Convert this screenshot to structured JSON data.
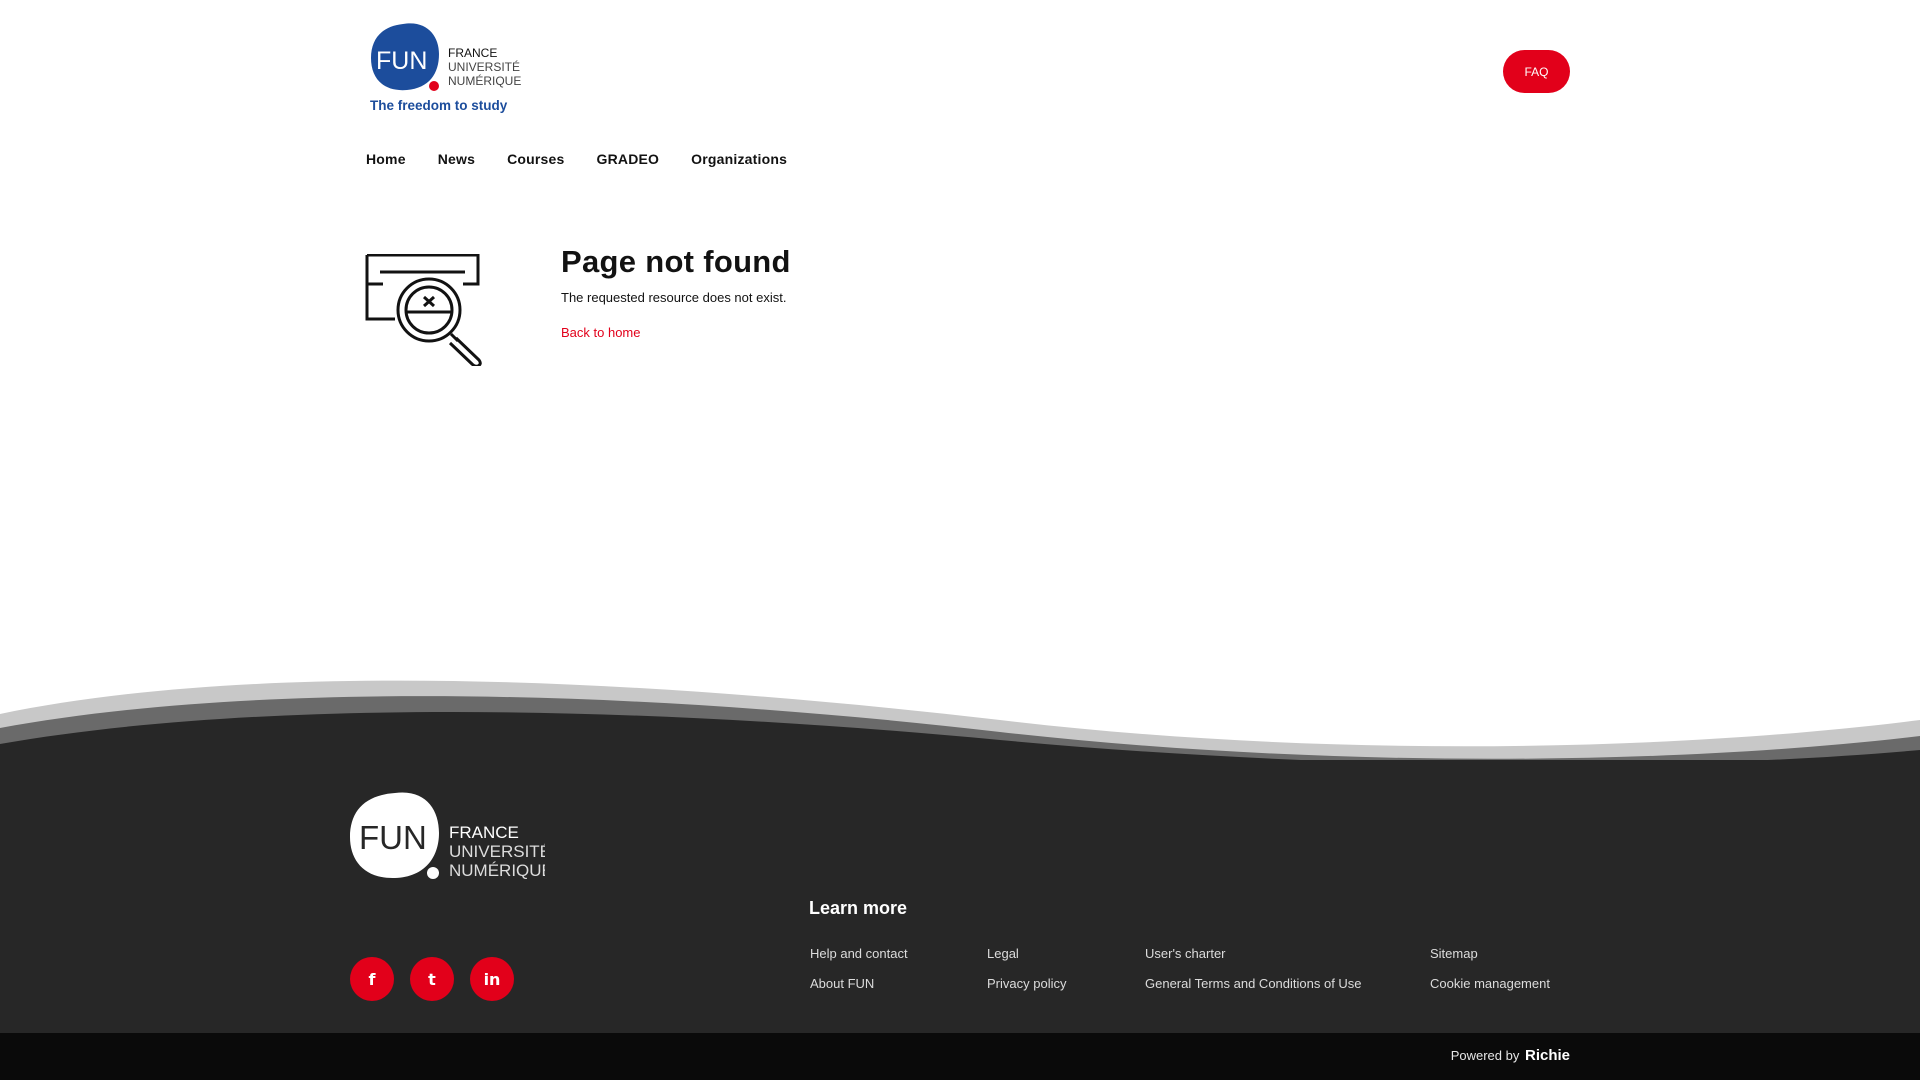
{
  "header": {
    "logo": {
      "line1": "FUN",
      "line2": "FRANCE",
      "line3": "UNIVERSITÉ",
      "line4": "NUMÉRIQUE",
      "tagline": "The freedom to study",
      "color_blue": "#1c4d9c",
      "color_red": "#e2001a"
    },
    "faq_label": "FAQ"
  },
  "nav": {
    "items": [
      "Home",
      "News",
      "Courses",
      "GRADEO",
      "Organizations"
    ]
  },
  "not_found": {
    "title": "Page not found",
    "message": "The requested resource does not exist.",
    "back_link": "Back to home"
  },
  "footer": {
    "logo": {
      "line1": "FUN",
      "line2": "FRANCE",
      "line3": "UNIVERSITÉ",
      "line4": "NUMÉRIQUE"
    },
    "social": [
      {
        "icon": "facebook-icon",
        "glyph": "f"
      },
      {
        "icon": "twitter-icon",
        "glyph": "t"
      },
      {
        "icon": "linkedin-icon",
        "glyph": "in"
      }
    ],
    "learn_more_title": "Learn more",
    "links": {
      "help": "Help and contact",
      "about": "About FUN",
      "legal": "Legal",
      "privacy": "Privacy policy",
      "charter": "User's charter",
      "terms": "General Terms and Conditions of Use",
      "sitemap": "Sitemap",
      "cookie": "Cookie management"
    },
    "powered_prefix": "Powered by",
    "powered_brand": "Richie",
    "bg_color": "#272727"
  },
  "colors": {
    "accent": "#e2001a",
    "text": "#121212"
  }
}
